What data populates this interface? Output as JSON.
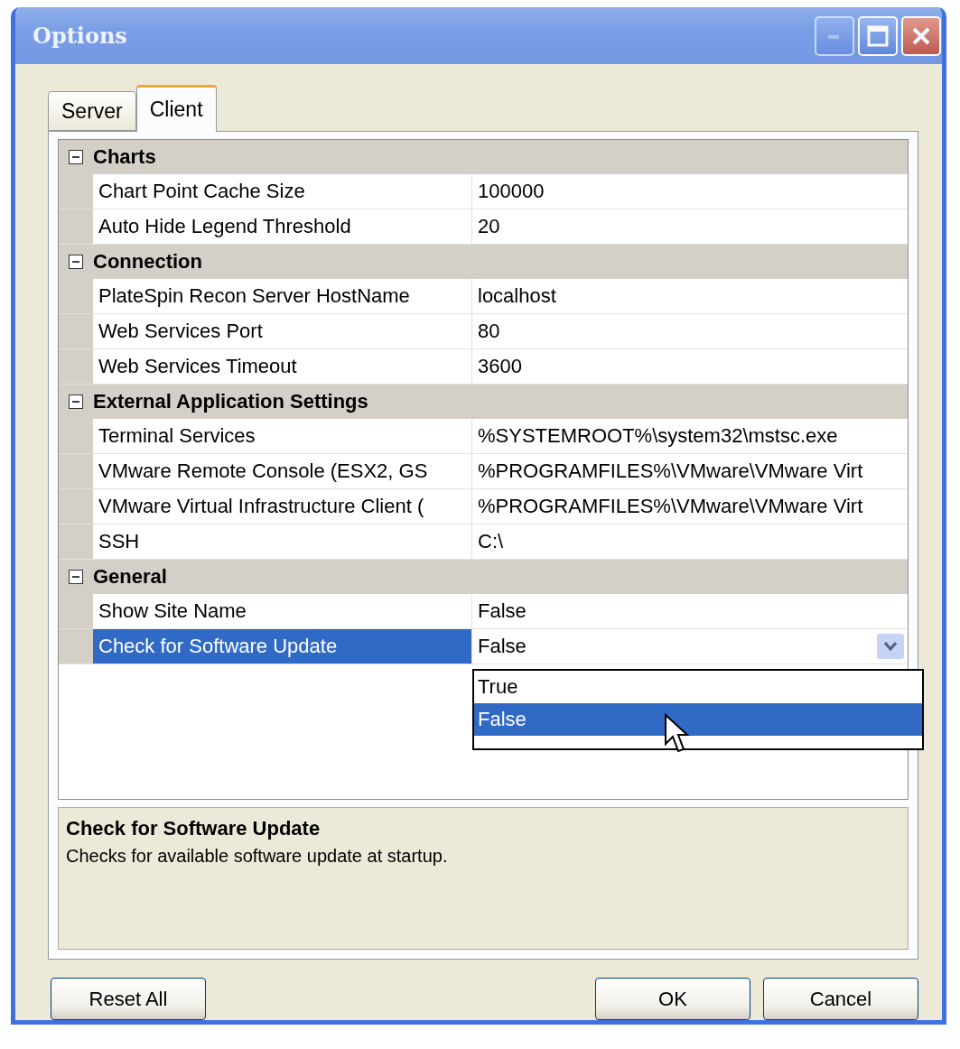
{
  "window": {
    "title": "Options"
  },
  "tabs": [
    {
      "label": "Server",
      "selected": false
    },
    {
      "label": "Client",
      "selected": true
    }
  ],
  "property_grid": {
    "categories": [
      {
        "name": "Charts",
        "expanded": true,
        "properties": [
          {
            "name": "Chart Point Cache Size",
            "value": "100000",
            "selected": false
          },
          {
            "name": "Auto Hide Legend Threshold",
            "value": "20",
            "selected": false
          }
        ]
      },
      {
        "name": "Connection",
        "expanded": true,
        "properties": [
          {
            "name": "PlateSpin Recon Server HostName",
            "value": "localhost",
            "selected": false
          },
          {
            "name": "Web Services Port",
            "value": "80",
            "selected": false
          },
          {
            "name": "Web Services Timeout",
            "value": "3600",
            "selected": false
          }
        ]
      },
      {
        "name": "External Application Settings",
        "expanded": true,
        "properties": [
          {
            "name": "Terminal Services",
            "value": "%SYSTEMROOT%\\system32\\mstsc.exe",
            "selected": false
          },
          {
            "name": "VMware Remote Console (ESX2, GS",
            "value": "%PROGRAMFILES%\\VMware\\VMware Virt",
            "selected": false
          },
          {
            "name": "VMware Virtual Infrastructure Client (",
            "value": "%PROGRAMFILES%\\VMware\\VMware Virt",
            "selected": false
          },
          {
            "name": "SSH",
            "value": "C:\\",
            "selected": false
          }
        ]
      },
      {
        "name": "General",
        "expanded": true,
        "properties": [
          {
            "name": "Show Site Name",
            "value": "False",
            "selected": false
          },
          {
            "name": "Check for Software Update",
            "value": "False",
            "selected": true,
            "dropdown": {
              "options": [
                {
                  "label": "True",
                  "selected": false
                },
                {
                  "label": "False",
                  "selected": true
                }
              ]
            }
          }
        ]
      }
    ]
  },
  "description": {
    "title": "Check for Software Update",
    "text": "Checks for available software update at startup."
  },
  "buttons": [
    {
      "label": "Reset All"
    },
    {
      "label": "OK"
    },
    {
      "label": "Cancel"
    }
  ]
}
